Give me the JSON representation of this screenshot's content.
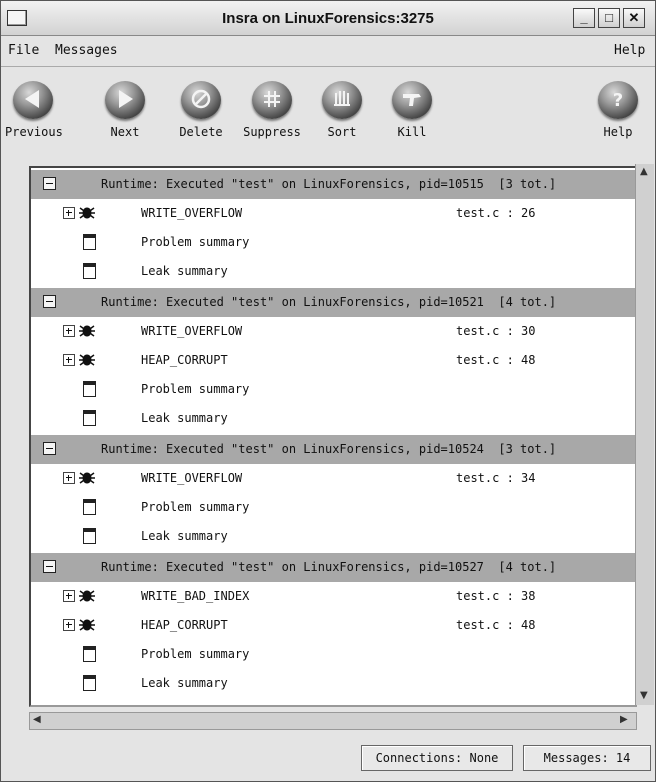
{
  "window": {
    "title": "Insra on LinuxForensics:3275",
    "controls": [
      "_",
      "□",
      "✕"
    ]
  },
  "menu": {
    "file": "File",
    "messages": "Messages",
    "help": "Help"
  },
  "toolbar": {
    "previous": "Previous",
    "next": "Next",
    "delete": "Delete",
    "suppress": "Suppress",
    "sort": "Sort",
    "kill": "Kill",
    "help": "Help"
  },
  "groups": [
    {
      "header": "Runtime: Executed \"test\" on LinuxForensics, pid=10515  [3 tot.]",
      "items": [
        {
          "type": "error",
          "name": "WRITE_OVERFLOW",
          "location": "test.c : 26"
        },
        {
          "type": "summary",
          "name": "Problem summary"
        },
        {
          "type": "summary",
          "name": "Leak summary"
        }
      ]
    },
    {
      "header": "Runtime: Executed \"test\" on LinuxForensics, pid=10521  [4 tot.]",
      "items": [
        {
          "type": "error",
          "name": "WRITE_OVERFLOW",
          "location": "test.c : 30"
        },
        {
          "type": "error",
          "name": "HEAP_CORRUPT",
          "location": "test.c : 48"
        },
        {
          "type": "summary",
          "name": "Problem summary"
        },
        {
          "type": "summary",
          "name": "Leak summary"
        }
      ]
    },
    {
      "header": "Runtime: Executed \"test\" on LinuxForensics, pid=10524  [3 tot.]",
      "items": [
        {
          "type": "error",
          "name": "WRITE_OVERFLOW",
          "location": "test.c : 34"
        },
        {
          "type": "summary",
          "name": "Problem summary"
        },
        {
          "type": "summary",
          "name": "Leak summary"
        }
      ]
    },
    {
      "header": "Runtime: Executed \"test\" on LinuxForensics, pid=10527  [4 tot.]",
      "items": [
        {
          "type": "error",
          "name": "WRITE_BAD_INDEX",
          "location": "test.c : 38"
        },
        {
          "type": "error",
          "name": "HEAP_CORRUPT",
          "location": "test.c : 48"
        },
        {
          "type": "summary",
          "name": "Problem summary"
        },
        {
          "type": "summary",
          "name": "Leak summary"
        }
      ]
    }
  ],
  "status": {
    "connections": "Connections: None",
    "messages": "Messages: 14"
  }
}
